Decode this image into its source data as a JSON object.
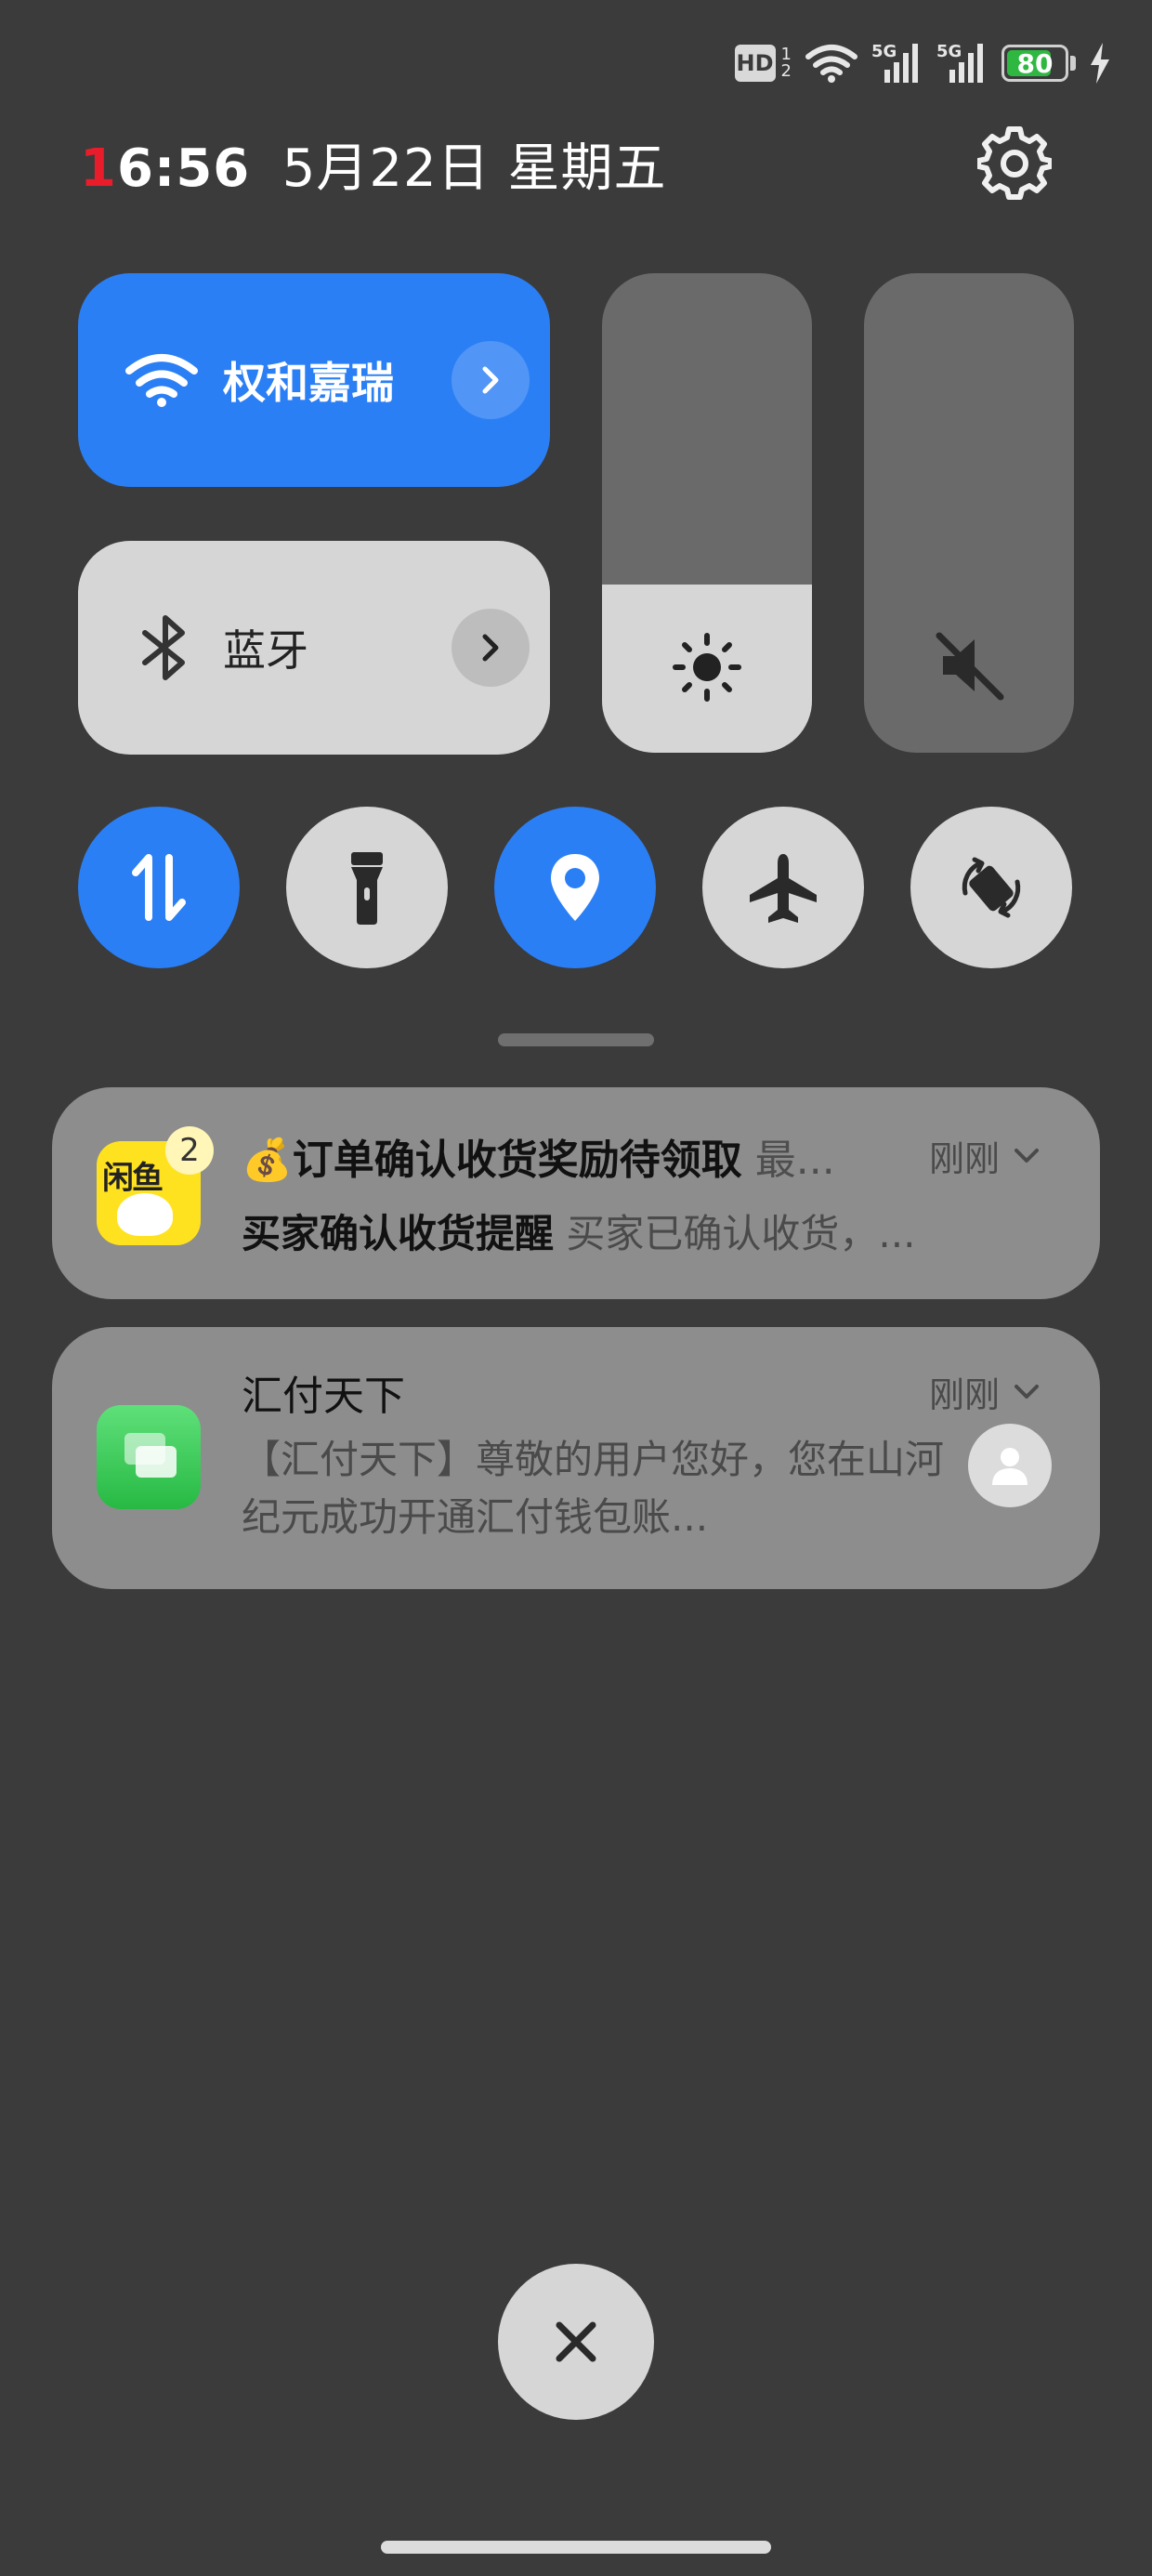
{
  "status_bar": {
    "hd_label": "HD",
    "sim_slot_top": "1",
    "sim_slot_bottom": "2",
    "network_1": "5G",
    "network_2": "5G",
    "battery_level": 80,
    "battery_label": "80",
    "charging": true
  },
  "header": {
    "time_first_digit": "1",
    "time_rest": "6:56",
    "date": "5月22日 星期五",
    "icons": [
      "settings-icon"
    ]
  },
  "tiles": {
    "wifi": {
      "label": "权和嘉瑞",
      "active": true,
      "icon": "wifi-icon"
    },
    "bluetooth": {
      "label": "蓝牙",
      "active": false,
      "icon": "bluetooth-icon"
    },
    "brightness": {
      "icon": "sun-icon",
      "level_fraction": 0.35
    },
    "volume": {
      "icon": "mute-icon",
      "level_fraction": 0.0
    }
  },
  "toggles": [
    {
      "name": "mobile-data",
      "icon": "data-arrows-icon",
      "active": true
    },
    {
      "name": "flashlight",
      "icon": "flashlight-icon",
      "active": false
    },
    {
      "name": "location",
      "icon": "location-pin-icon",
      "active": true
    },
    {
      "name": "airplane-mode",
      "icon": "airplane-icon",
      "active": false
    },
    {
      "name": "auto-rotate",
      "icon": "rotate-icon",
      "active": false
    }
  ],
  "notifications": [
    {
      "app": "闲鱼",
      "app_icon_text": "闲鱼",
      "badge": "2",
      "title_emoji": "💰",
      "title": "订单确认收货奖励待领取",
      "title_more": " 最...",
      "time": "刚刚",
      "body_bold": "买家确认收货提醒",
      "body": " 买家已确认收货，..."
    },
    {
      "app": "信息",
      "title": "汇付天下",
      "time": "刚刚",
      "body": "【汇付天下】尊敬的用户您好，您在山河纪元成功开通汇付钱包账..."
    }
  ],
  "colors": {
    "background": "#3b3b3b",
    "accent_blue": "#2b7ff5",
    "tile_off": "#d6d6d6",
    "notification_bg": "#8d8d8d",
    "battery_green": "#2fb841",
    "time_red": "#e81c2a"
  }
}
